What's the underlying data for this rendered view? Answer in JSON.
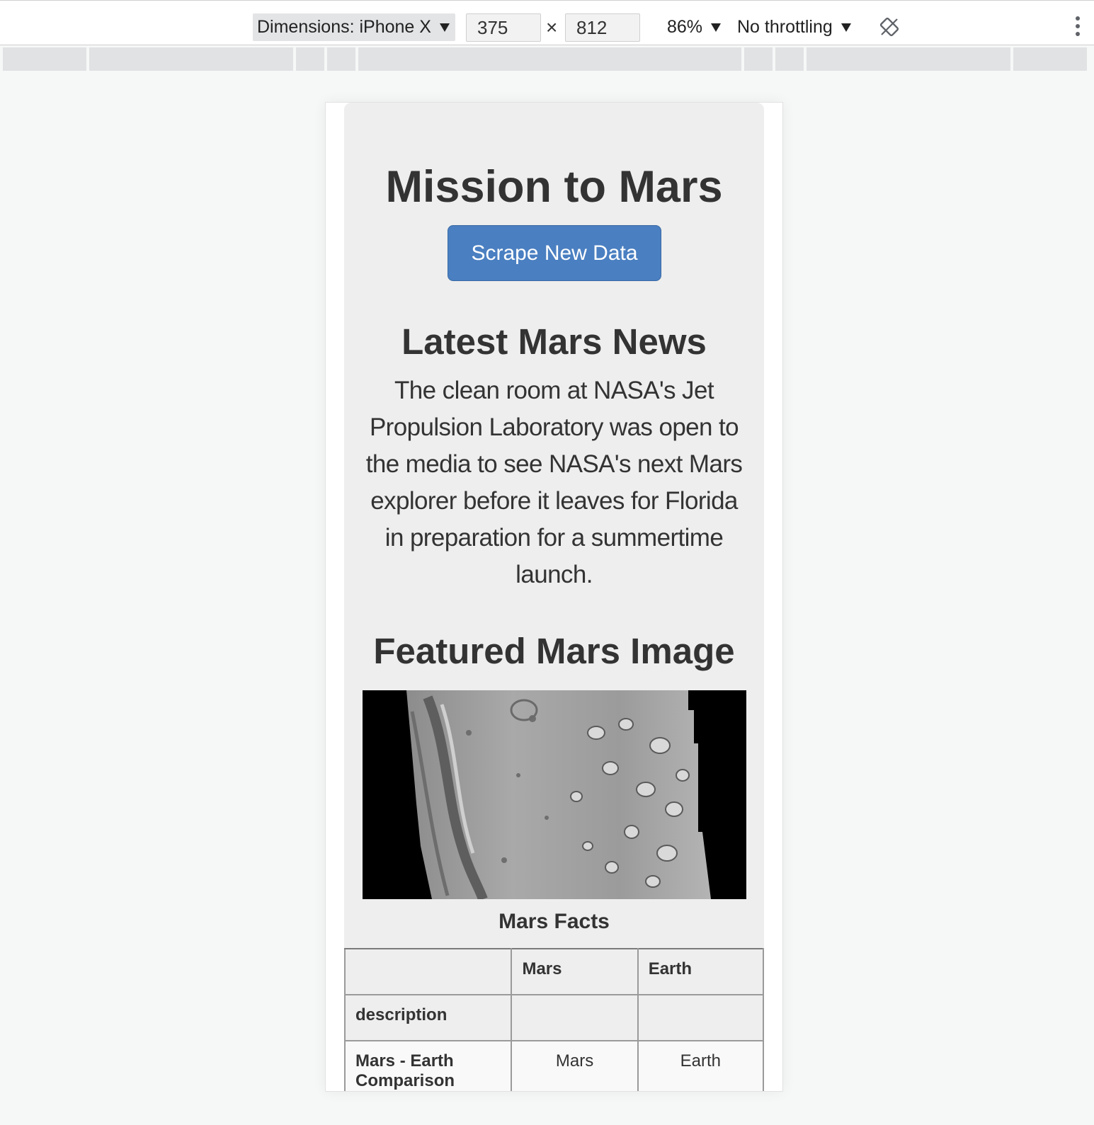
{
  "devtools": {
    "dimensions_label": "Dimensions: iPhone X",
    "width_value": "375",
    "times_sign": "×",
    "height_value": "812",
    "zoom_label": "86%",
    "throttling_label": "No throttling",
    "icons": [
      "chevron-down-icon",
      "rotate-icon",
      "more-vert-icon"
    ]
  },
  "page": {
    "title": "Mission to Mars",
    "scrape_button": "Scrape New Data",
    "news": {
      "heading": "Latest Mars News",
      "paragraph": "The clean room at NASA's Jet Propulsion Laboratory was open to the media to see NASA's next Mars explorer before it leaves for Florida in preparation for a summertime launch."
    },
    "featured": {
      "heading": "Featured Mars Image"
    },
    "facts": {
      "caption": "Mars Facts",
      "columns": [
        "",
        "Mars",
        "Earth"
      ],
      "rows": [
        {
          "label": "description",
          "mars": "",
          "earth": ""
        },
        {
          "label": "Mars - Earth Comparison",
          "mars": "Mars",
          "earth": "Earth"
        }
      ]
    }
  },
  "colors": {
    "button_blue": "#4a7fc1",
    "jumbotron_gray": "#eeeeee",
    "canvas_bg": "#f6f7f7"
  }
}
